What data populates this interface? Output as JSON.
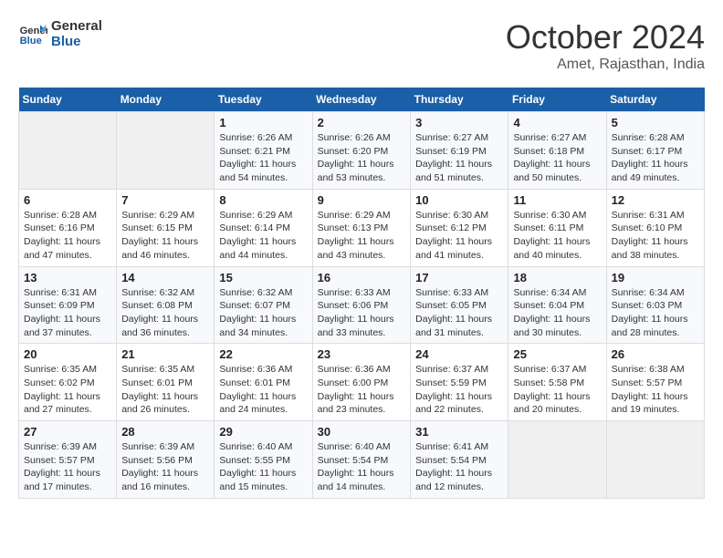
{
  "logo": {
    "text_general": "General",
    "text_blue": "Blue"
  },
  "title": "October 2024",
  "subtitle": "Amet, Rajasthan, India",
  "days_of_week": [
    "Sunday",
    "Monday",
    "Tuesday",
    "Wednesday",
    "Thursday",
    "Friday",
    "Saturday"
  ],
  "weeks": [
    [
      {
        "day": "",
        "info": ""
      },
      {
        "day": "",
        "info": ""
      },
      {
        "day": "1",
        "info": "Sunrise: 6:26 AM\nSunset: 6:21 PM\nDaylight: 11 hours and 54 minutes."
      },
      {
        "day": "2",
        "info": "Sunrise: 6:26 AM\nSunset: 6:20 PM\nDaylight: 11 hours and 53 minutes."
      },
      {
        "day": "3",
        "info": "Sunrise: 6:27 AM\nSunset: 6:19 PM\nDaylight: 11 hours and 51 minutes."
      },
      {
        "day": "4",
        "info": "Sunrise: 6:27 AM\nSunset: 6:18 PM\nDaylight: 11 hours and 50 minutes."
      },
      {
        "day": "5",
        "info": "Sunrise: 6:28 AM\nSunset: 6:17 PM\nDaylight: 11 hours and 49 minutes."
      }
    ],
    [
      {
        "day": "6",
        "info": "Sunrise: 6:28 AM\nSunset: 6:16 PM\nDaylight: 11 hours and 47 minutes."
      },
      {
        "day": "7",
        "info": "Sunrise: 6:29 AM\nSunset: 6:15 PM\nDaylight: 11 hours and 46 minutes."
      },
      {
        "day": "8",
        "info": "Sunrise: 6:29 AM\nSunset: 6:14 PM\nDaylight: 11 hours and 44 minutes."
      },
      {
        "day": "9",
        "info": "Sunrise: 6:29 AM\nSunset: 6:13 PM\nDaylight: 11 hours and 43 minutes."
      },
      {
        "day": "10",
        "info": "Sunrise: 6:30 AM\nSunset: 6:12 PM\nDaylight: 11 hours and 41 minutes."
      },
      {
        "day": "11",
        "info": "Sunrise: 6:30 AM\nSunset: 6:11 PM\nDaylight: 11 hours and 40 minutes."
      },
      {
        "day": "12",
        "info": "Sunrise: 6:31 AM\nSunset: 6:10 PM\nDaylight: 11 hours and 38 minutes."
      }
    ],
    [
      {
        "day": "13",
        "info": "Sunrise: 6:31 AM\nSunset: 6:09 PM\nDaylight: 11 hours and 37 minutes."
      },
      {
        "day": "14",
        "info": "Sunrise: 6:32 AM\nSunset: 6:08 PM\nDaylight: 11 hours and 36 minutes."
      },
      {
        "day": "15",
        "info": "Sunrise: 6:32 AM\nSunset: 6:07 PM\nDaylight: 11 hours and 34 minutes."
      },
      {
        "day": "16",
        "info": "Sunrise: 6:33 AM\nSunset: 6:06 PM\nDaylight: 11 hours and 33 minutes."
      },
      {
        "day": "17",
        "info": "Sunrise: 6:33 AM\nSunset: 6:05 PM\nDaylight: 11 hours and 31 minutes."
      },
      {
        "day": "18",
        "info": "Sunrise: 6:34 AM\nSunset: 6:04 PM\nDaylight: 11 hours and 30 minutes."
      },
      {
        "day": "19",
        "info": "Sunrise: 6:34 AM\nSunset: 6:03 PM\nDaylight: 11 hours and 28 minutes."
      }
    ],
    [
      {
        "day": "20",
        "info": "Sunrise: 6:35 AM\nSunset: 6:02 PM\nDaylight: 11 hours and 27 minutes."
      },
      {
        "day": "21",
        "info": "Sunrise: 6:35 AM\nSunset: 6:01 PM\nDaylight: 11 hours and 26 minutes."
      },
      {
        "day": "22",
        "info": "Sunrise: 6:36 AM\nSunset: 6:01 PM\nDaylight: 11 hours and 24 minutes."
      },
      {
        "day": "23",
        "info": "Sunrise: 6:36 AM\nSunset: 6:00 PM\nDaylight: 11 hours and 23 minutes."
      },
      {
        "day": "24",
        "info": "Sunrise: 6:37 AM\nSunset: 5:59 PM\nDaylight: 11 hours and 22 minutes."
      },
      {
        "day": "25",
        "info": "Sunrise: 6:37 AM\nSunset: 5:58 PM\nDaylight: 11 hours and 20 minutes."
      },
      {
        "day": "26",
        "info": "Sunrise: 6:38 AM\nSunset: 5:57 PM\nDaylight: 11 hours and 19 minutes."
      }
    ],
    [
      {
        "day": "27",
        "info": "Sunrise: 6:39 AM\nSunset: 5:57 PM\nDaylight: 11 hours and 17 minutes."
      },
      {
        "day": "28",
        "info": "Sunrise: 6:39 AM\nSunset: 5:56 PM\nDaylight: 11 hours and 16 minutes."
      },
      {
        "day": "29",
        "info": "Sunrise: 6:40 AM\nSunset: 5:55 PM\nDaylight: 11 hours and 15 minutes."
      },
      {
        "day": "30",
        "info": "Sunrise: 6:40 AM\nSunset: 5:54 PM\nDaylight: 11 hours and 14 minutes."
      },
      {
        "day": "31",
        "info": "Sunrise: 6:41 AM\nSunset: 5:54 PM\nDaylight: 11 hours and 12 minutes."
      },
      {
        "day": "",
        "info": ""
      },
      {
        "day": "",
        "info": ""
      }
    ]
  ]
}
